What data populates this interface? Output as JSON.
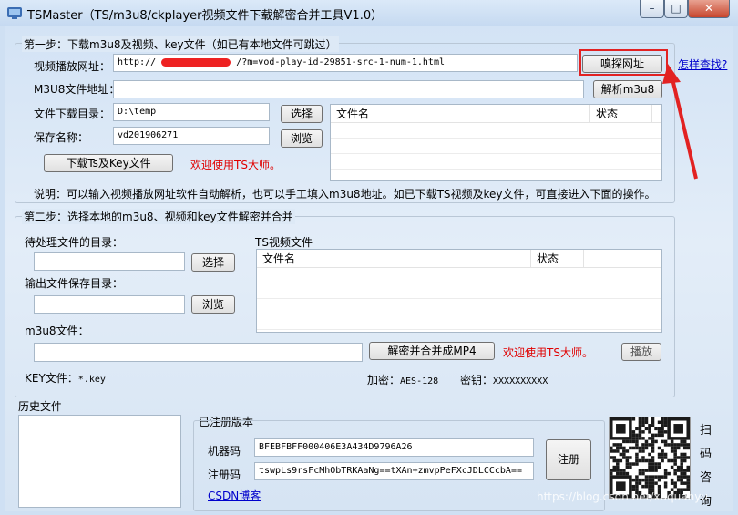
{
  "window": {
    "title": "TSMaster（TS/m3u8/ckplayer视频文件下载解密合并工具V1.0）",
    "minimize_glyph": "–",
    "maximize_glyph": "□",
    "close_glyph": "✕"
  },
  "step1": {
    "title": "第一步：下载m3u8及视频、key文件（如已有本地文件可跳过）",
    "video_url_label": "视频播放网址：",
    "video_url_prefix": "http://",
    "video_url_suffix": "/?m=vod-play-id-29851-src-1-num-1.html",
    "sniff_button": "嗅探网址",
    "how_to_find_link": "怎样查找?",
    "m3u8_label": "M3U8文件地址：",
    "m3u8_value": "",
    "parse_button": "解析m3u8",
    "download_dir_label": "文件下载目录：",
    "download_dir_value": "D:\\temp",
    "choose_button": "选择",
    "save_name_label": "保存名称：",
    "save_name_value": "vd201906271",
    "browse_button": "浏览",
    "download_button": "下载Ts及Key文件",
    "welcome": "欢迎使用TS大师。",
    "file_table": {
      "columns": [
        "文件名",
        "状态"
      ],
      "rows": []
    },
    "note": "说明：可以输入视频播放网址软件自动解析，也可以手工填入m3u8地址。如已下载TS视频及key文件，可直接进入下面的操作。"
  },
  "step2": {
    "title": "第二步：选择本地的m3u8、视频和key文件解密并合并",
    "pending_dir_label": "待处理文件的目录：",
    "pending_dir_value": "",
    "choose_button": "选择",
    "output_dir_label": "输出文件保存目录：",
    "output_dir_value": "",
    "browse_button": "浏览",
    "ts_files_label": "TS视频文件",
    "ts_table": {
      "columns": [
        "文件名",
        "状态"
      ],
      "rows": []
    },
    "m3u8_file_label": "m3u8文件：",
    "m3u8_file_value": "",
    "decrypt_merge_button": "解密并合并成MP4",
    "welcome": "欢迎使用TS大师。",
    "play_button": "播放",
    "key_file_label": "KEY文件：",
    "key_file_value": "*.key",
    "encryption_label": "加密：",
    "encryption_value": "AES-128",
    "secret_key_label": "密钥：",
    "secret_key_value": "XXXXXXXXXX"
  },
  "history": {
    "label": "历史文件",
    "items": []
  },
  "registration": {
    "title": "已注册版本",
    "machine_code_label": "机器码",
    "machine_code_value": "BFEBFBFF000406E3A434D9796A26",
    "reg_code_label": "注册码",
    "reg_code_value": "tswpLs9rsFcMhObTRKAaNg==tXAn+zmvpPeFXcJDLCCcbA==",
    "register_button": "注册",
    "csdn_link": "CSDN博客"
  },
  "qr": {
    "caption_chars": [
      "扫",
      "码",
      "咨",
      "询"
    ]
  },
  "watermark": "https://blog.csdn.net/xuquanyu",
  "colors": {
    "annotation_red": "#e22222",
    "link_blue": "#0000cc",
    "welcome_red": "#e00000"
  }
}
